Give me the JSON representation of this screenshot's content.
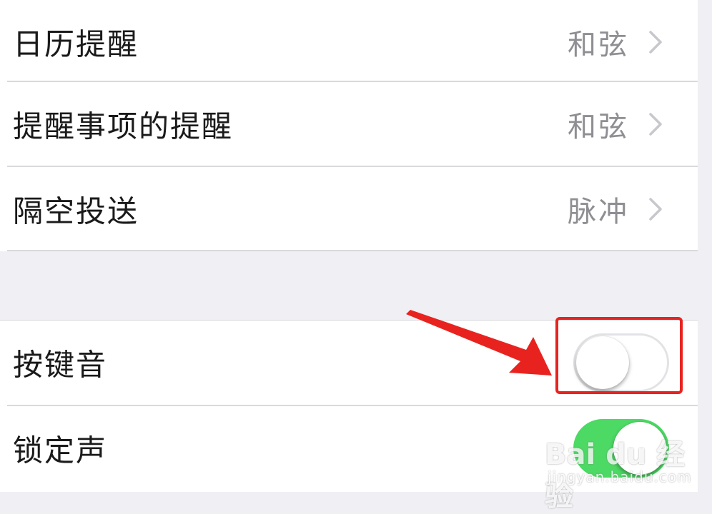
{
  "settings": {
    "sounds": [
      {
        "label": "日历提醒",
        "value": "和弦"
      },
      {
        "label": "提醒事项的提醒",
        "value": "和弦"
      },
      {
        "label": "隔空投送",
        "value": "脉冲"
      }
    ],
    "toggles": [
      {
        "label": "按键音",
        "on": false
      },
      {
        "label": "锁定声",
        "on": true
      }
    ]
  },
  "colors": {
    "toggle_on": "#4cd964",
    "annotation_red": "#e8231f",
    "value_gray": "#8e8e93"
  },
  "icons": {
    "chevron": "chevron-right-icon",
    "arrow": "red-arrow-icon"
  },
  "watermark": {
    "brand": "Bai du 经验",
    "url": "jingyan.baidu.com"
  }
}
